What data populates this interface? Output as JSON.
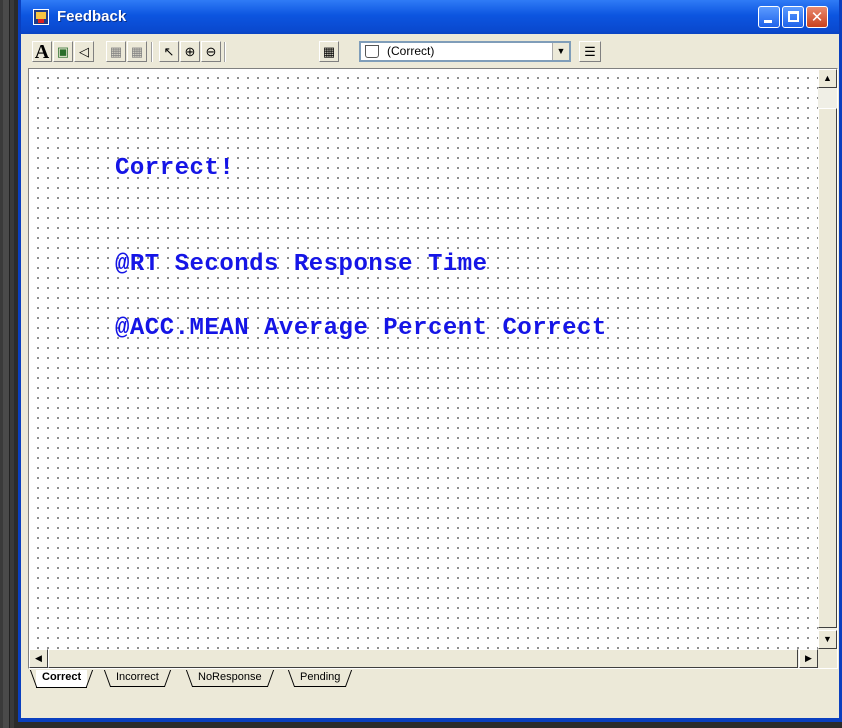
{
  "window": {
    "title": "Feedback",
    "title_bar_color": "#0b4fd8",
    "controls": [
      "minimize",
      "maximize",
      "close"
    ]
  },
  "toolbar": {
    "tools": [
      {
        "icon": "text-tool-icon",
        "glyph": "A"
      },
      {
        "icon": "image-tool-icon",
        "glyph": "▣"
      },
      {
        "icon": "sound-tool-icon",
        "glyph": "◁"
      },
      {
        "icon": "bring-forward-icon",
        "glyph": "▦"
      },
      {
        "icon": "send-backward-icon",
        "glyph": "▦"
      },
      {
        "icon": "select-arrow-icon",
        "glyph": "↖"
      },
      {
        "icon": "zoom-in-icon",
        "glyph": "⊕"
      },
      {
        "icon": "zoom-out-icon",
        "glyph": "⊖"
      },
      {
        "icon": "grid-icon",
        "glyph": "▦"
      }
    ],
    "state_selector": {
      "value": "(Correct)"
    },
    "properties_icon": "properties-icon"
  },
  "canvas": {
    "lines": [
      "Correct!",
      "@RT Seconds Response Time",
      "@ACC.MEAN Average Percent Correct"
    ],
    "text_color": "#1515e6"
  },
  "tabs": [
    {
      "label": "Correct",
      "active": true
    },
    {
      "label": "Incorrect",
      "active": false
    },
    {
      "label": "NoResponse",
      "active": false
    },
    {
      "label": "Pending",
      "active": false
    }
  ]
}
